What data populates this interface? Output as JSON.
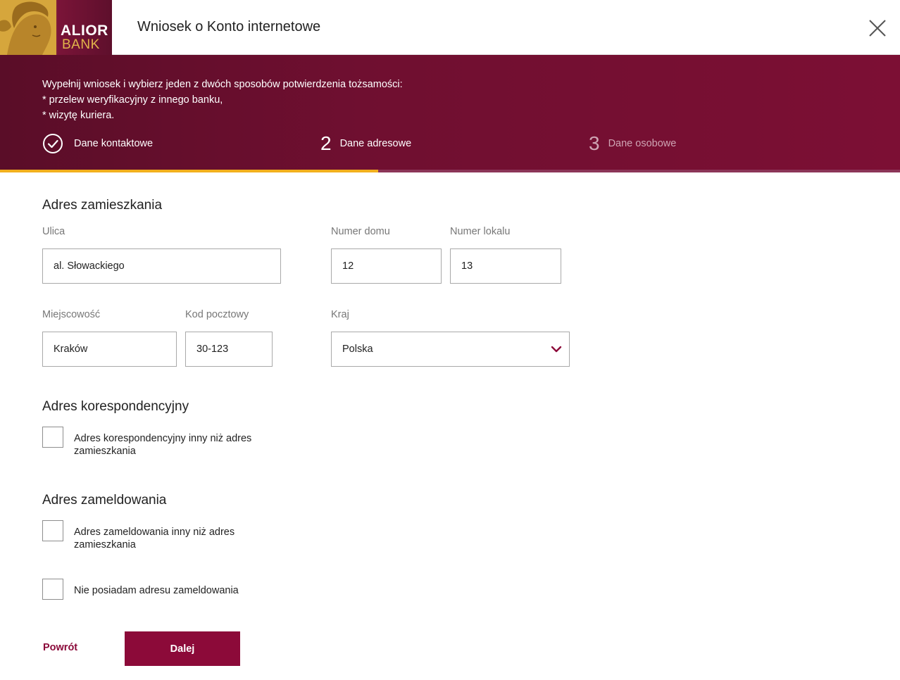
{
  "header": {
    "logo_text_1": "ALIOR",
    "logo_text_2": "BANK",
    "title": "Wniosek o Konto internetowe"
  },
  "banner": {
    "intro": "Wypełnij wniosek i wybierz jeden z dwóch sposobów potwierdzenia tożsamości:",
    "option_1": "* przelew weryfikacyjny z innego banku,",
    "option_2": "* wizytę kuriera.",
    "steps": [
      {
        "number": "",
        "label": "Dane kontaktowe",
        "state": "done"
      },
      {
        "number": "2",
        "label": "Dane adresowe",
        "state": "active"
      },
      {
        "number": "3",
        "label": "Dane osobowe",
        "state": "pending"
      }
    ],
    "progress_fraction": 0.42
  },
  "residence": {
    "title": "Adres zamieszkania",
    "street_label": "Ulica",
    "street_value": "al. Słowackiego",
    "house_label": "Numer domu",
    "house_value": "12",
    "flat_label": "Numer lokalu",
    "flat_value": "13",
    "city_label": "Miejscowość",
    "city_value": "Kraków",
    "postal_label": "Kod pocztowy",
    "postal_value": "30-123",
    "country_label": "Kraj",
    "country_value": "Polska"
  },
  "correspondence": {
    "title": "Adres korespondencyjny",
    "checkbox_line1": "Adres korespondencyjny inny niż adres",
    "checkbox_line2": "zamieszkania"
  },
  "registration": {
    "title": "Adres zameldowania",
    "checkbox_line1": "Adres zameldowania inny niż adres",
    "checkbox_line2": "zamieszkania",
    "no_address_label": "Nie posiadam adresu zameldowania"
  },
  "actions": {
    "back_label": "Powrót",
    "next_label": "Dalej"
  },
  "colors": {
    "brand": "#8c0a39",
    "accent": "#f2b01e"
  }
}
